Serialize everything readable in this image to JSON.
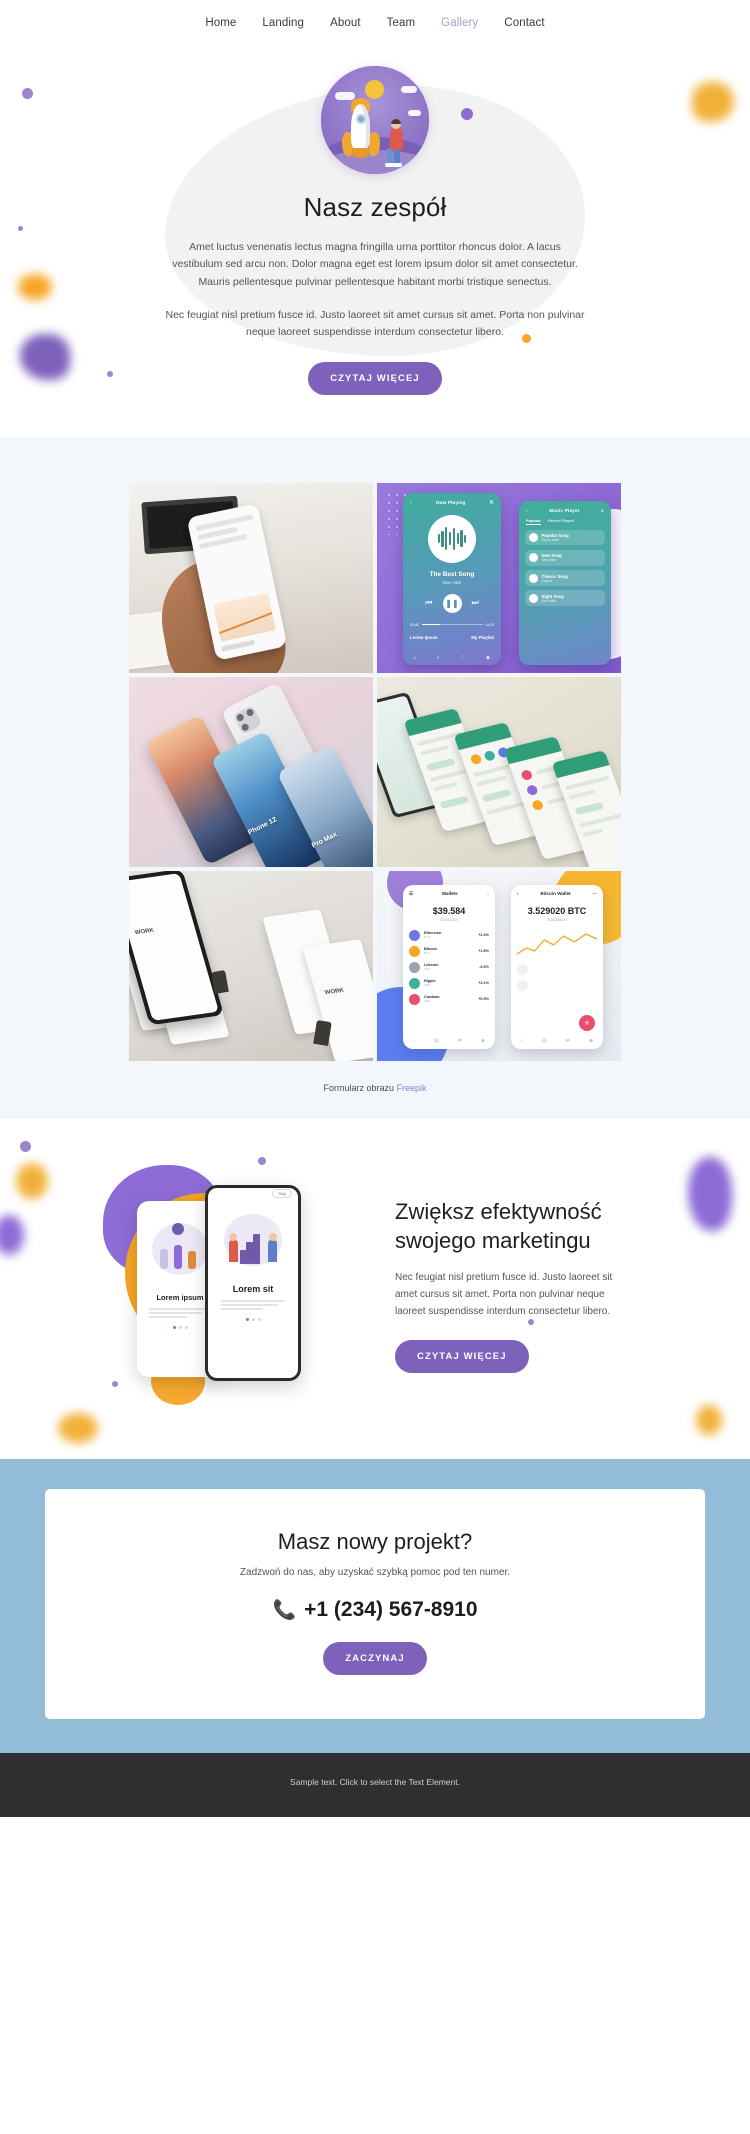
{
  "nav": {
    "items": [
      {
        "label": "Home",
        "active": false
      },
      {
        "label": "Landing",
        "active": false
      },
      {
        "label": "About",
        "active": false
      },
      {
        "label": "Team",
        "active": false
      },
      {
        "label": "Gallery",
        "active": true
      },
      {
        "label": "Contact",
        "active": false
      }
    ]
  },
  "hero": {
    "title": "Nasz zespół",
    "paragraph1": "Amet luctus venenatis lectus magna fringilla urna porttitor rhoncus dolor. A lacus vestibulum sed arcu non. Dolor magna eget est lorem ipsum dolor sit amet consectetur. Mauris pellentesque pulvinar pellentesque habitant morbi tristique senectus.",
    "paragraph2": "Nec feugiat nisl pretium fusce id. Justo laoreet sit amet cursus sit amet. Porta non pulvinar neque laoreet suspendisse interdum consectetur libero.",
    "button": "CZYTAJ WIĘCEJ",
    "illustration": "rocket-launch-icon"
  },
  "gallery": {
    "caption_text": "Formularz obrazu",
    "caption_link": "Freepik",
    "items": [
      {
        "name": "hand-holding-phone-photo",
        "alt": "Hand holding smartphone over desk"
      },
      {
        "name": "music-player-app-mockup",
        "alt": "Music player app screens"
      },
      {
        "name": "phones-pink-backdrop-photo",
        "alt": "iPhone 12 Pro Max devices on pink surface"
      },
      {
        "name": "chat-app-screens-mockup",
        "alt": "Green chat app screens perspective"
      },
      {
        "name": "grey-perspective-screens-photo",
        "alt": "Phone and UI screens on grey surface"
      },
      {
        "name": "wallet-bitcoin-app-mockup",
        "alt": "Crypto wallet app screens"
      }
    ],
    "music_player": {
      "screen1": {
        "header": "Now Playing",
        "song": "The Best Song",
        "artist": "New Artist",
        "time_start": "02:48",
        "time_end": "04:25",
        "foot_left": "Lorem Ipsum",
        "foot_right": "My Playlist"
      },
      "screen2": {
        "header": "Music Player",
        "tab_active": "Popular",
        "tab_inactive": "Recent Played",
        "tracks": [
          {
            "title": "Popular Song",
            "sub": "Top on Artist"
          },
          {
            "title": "New Song",
            "sub": "New Artist"
          },
          {
            "title": "Classic Song",
            "sub": "Legend"
          },
          {
            "title": "Night Song",
            "sub": "New Artist"
          }
        ]
      }
    },
    "phones_labels": [
      "Phone 12",
      "Pro Max"
    ],
    "wallet": {
      "screen1": {
        "header": "Wallets",
        "amount": "$39.584",
        "amount_sub": "33.04.2021",
        "rows": [
          {
            "title": "Ethereum",
            "sub": "ETH",
            "value": "+2.4%"
          },
          {
            "title": "Bitcoin",
            "sub": "BTC",
            "value": "+1.8%"
          },
          {
            "title": "Litecoin",
            "sub": "LTC",
            "value": "-0.6%"
          },
          {
            "title": "Ripple",
            "sub": "XRP",
            "value": "+3.1%"
          },
          {
            "title": "Cardano",
            "sub": "ADA",
            "value": "+0.9%"
          }
        ]
      },
      "screen2": {
        "header": "Bitcoin Wallet",
        "amount": "3.529020 BTC",
        "amount_sub": "$ 39.584,00"
      }
    }
  },
  "marketing": {
    "title": "Zwiększ efektywność swojego marketingu",
    "paragraph": "Nec feugiat nisl pretium fusce id. Justo laoreet sit amet cursus sit amet. Porta non pulvinar neque laoreet suspendisse interdum consectetur libero.",
    "button": "CZYTAJ WIĘCEJ",
    "phone_back_caption": "Lorem ipsum",
    "phone_front_caption": "Lorem sit",
    "phone_chip": "Skip"
  },
  "cta": {
    "title": "Masz nowy projekt?",
    "subtitle": "Zadzwoń do nas, aby uzyskać szybką pomoc pod ten numer.",
    "phone": "+1 (234) 567-8910",
    "phone_icon": "phone-icon",
    "button": "ZACZYNAJ"
  },
  "footer": {
    "text": "Sample text. Click to select the Text Element."
  },
  "colors": {
    "accent_purple": "#7d61ba",
    "accent_orange": "#f5a623",
    "cta_blue": "#93bcd9",
    "footer_dark": "#2f2f2f",
    "gallery_bg": "#f3f7fb",
    "link_purple": "#8e7bd0"
  }
}
